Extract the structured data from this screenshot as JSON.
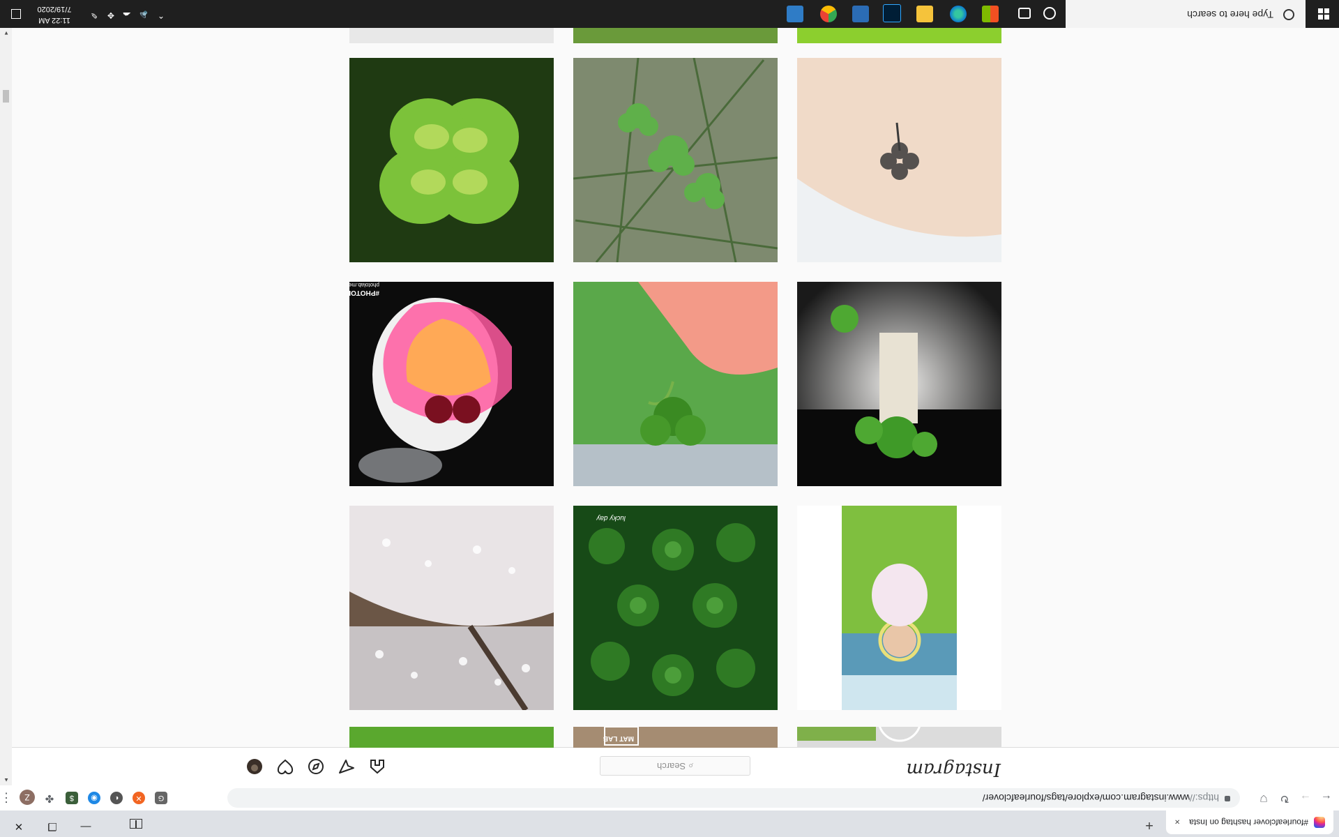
{
  "browser": {
    "tab_title": "#fourleafclover hashtag on Insta",
    "new_tab": "+",
    "close_tab": "×",
    "url_prefix": "https://",
    "url_rest": "www.instagram.com/explore/tags/fourleafclover/",
    "profile_initial": "Z",
    "window_buttons": {
      "minimize": "—",
      "restore": "❐",
      "close": "✕"
    }
  },
  "instagram": {
    "logo": "Instagram",
    "search_placeholder": "Search",
    "search_glyph": "⌕",
    "nav_icons": [
      "home-icon",
      "direct-icon",
      "explore-icon",
      "activity-icon",
      "profile-avatar"
    ]
  },
  "grid": {
    "rows": [
      [
        "green clover leaf",
        "clovers in grass",
        "clover tattoo"
      ],
      [
        "neon portrait art",
        "hand holding clover",
        "clover in vase"
      ],
      [
        "cherry blossoms",
        "clover patch",
        "child in flower crown"
      ]
    ],
    "captions": {
      "photolab": "#PHOTOLAB",
      "photolab_sub": "photolab.me",
      "lucky": "lucky day",
      "matlab": "MAT LAB"
    }
  },
  "taskbar": {
    "search_placeholder": "Type here to search",
    "time": "11:22 AM",
    "date": "7/19/2020"
  }
}
